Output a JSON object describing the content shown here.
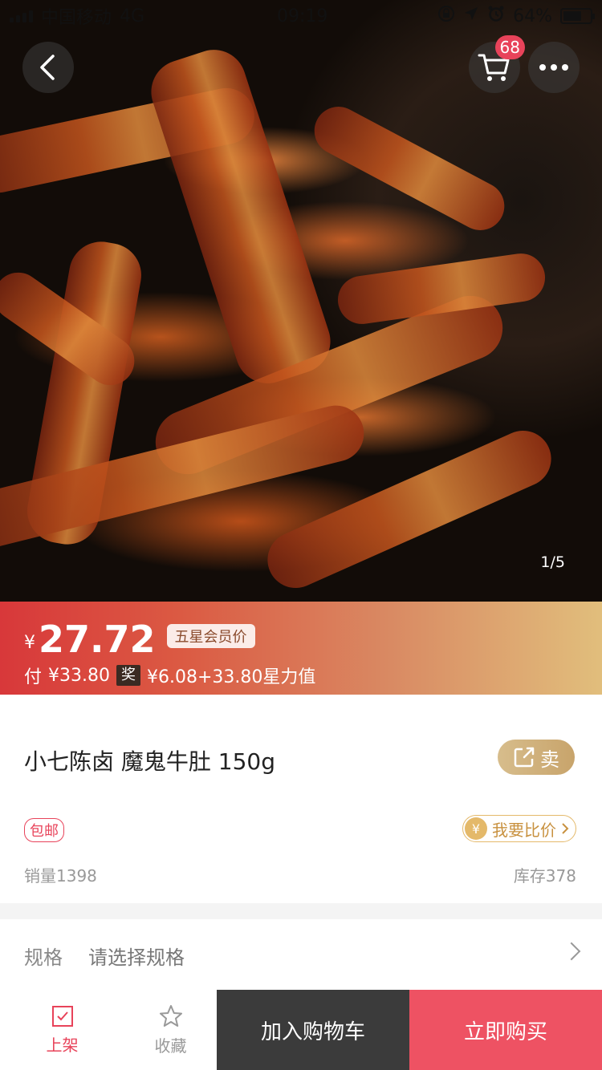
{
  "status_bar": {
    "carrier": "中国移动",
    "network": "4G",
    "time": "09:19",
    "battery": "64%"
  },
  "header": {
    "cart_count": "68"
  },
  "gallery": {
    "counter": "1/5"
  },
  "price": {
    "currency": "¥",
    "value": "27.72",
    "member_tag": "五星会员价",
    "pay_prefix": "付",
    "pay_amount": "¥33.80",
    "reward_tag": "奖",
    "reward_text": "¥6.08+33.80星力值"
  },
  "product": {
    "title": "小七陈卤 魔鬼牛肚 150g",
    "share_label": "卖",
    "free_shipping": "包邮",
    "compare_label": "我要比价",
    "sales": "销量1398",
    "stock": "库存378"
  },
  "spec": {
    "label": "规格",
    "value": "请选择规格"
  },
  "bottom_bar": {
    "list_label": "上架",
    "fav_label": "收藏",
    "add_cart_label": "加入购物车",
    "buy_now_label": "立即购买"
  },
  "colors": {
    "accent_red": "#ee5263",
    "dark_button": "#3b3b3b",
    "gold": "#e4b96a"
  }
}
